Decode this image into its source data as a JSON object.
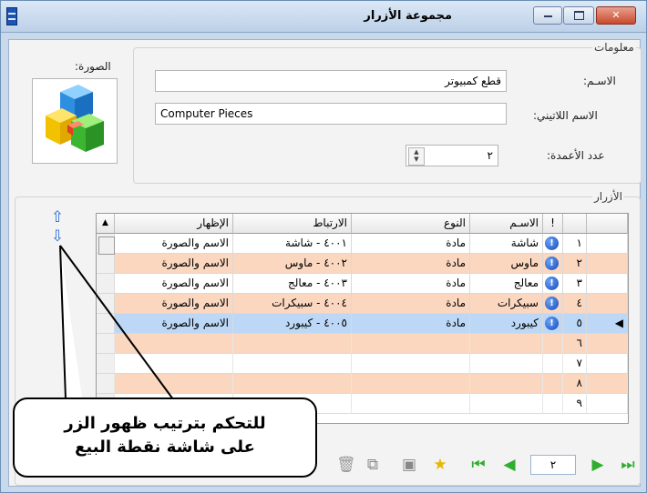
{
  "window": {
    "title": "مجموعة الأزرار"
  },
  "info_group": {
    "legend": "معلومات",
    "name_label": "الاسـم:",
    "name_value": "قطع كمبيوتر",
    "latin_label": "الاسم اللاتيني:",
    "latin_value": "Computer Pieces",
    "columns_label": "عدد الأعمدة:",
    "columns_value": "٢"
  },
  "image": {
    "label": "الصورة:",
    "icon": "colored-cubes-icon"
  },
  "buttons_group": {
    "legend": "الأزرار",
    "headers": {
      "indicator": "",
      "icon": "!",
      "name": "الاسـم",
      "type": "النوع",
      "link": "الارتباط",
      "display": "الإظهار"
    },
    "rows": [
      {
        "num": "١",
        "name": "شاشة",
        "type": "مادة",
        "link": "٤٠٠١ - شاشة",
        "display": "الاسم والصورة",
        "style": "white"
      },
      {
        "num": "٢",
        "name": "ماوس",
        "type": "مادة",
        "link": "٤٠٠٢ - ماوس",
        "display": "الاسم والصورة",
        "style": "orange"
      },
      {
        "num": "٣",
        "name": "معالج",
        "type": "مادة",
        "link": "٤٠٠٣ - معالج",
        "display": "الاسم والصورة",
        "style": "white"
      },
      {
        "num": "٤",
        "name": "سبيكرات",
        "type": "مادة",
        "link": "٤٠٠٤ - سبيكرات",
        "display": "الاسم والصورة",
        "style": "orange"
      },
      {
        "num": "٥",
        "name": "كيبورد",
        "type": "مادة",
        "link": "٤٠٠٥ - كيبورد",
        "display": "الاسم والصورة",
        "style": "selected"
      },
      {
        "num": "٦",
        "name": "",
        "type": "",
        "link": "",
        "display": "",
        "style": "orange"
      },
      {
        "num": "٧",
        "name": "",
        "type": "",
        "link": "",
        "display": "",
        "style": "white"
      },
      {
        "num": "٨",
        "name": "",
        "type": "",
        "link": "",
        "display": "",
        "style": "orange"
      },
      {
        "num": "٩",
        "name": "",
        "type": "",
        "link": "",
        "display": "",
        "style": "white"
      }
    ]
  },
  "callout": {
    "line1": "للتحكم بترتيب ظهور الزر",
    "line2": "على شاشة نقطة البيع"
  },
  "navigator": {
    "page": "٢"
  },
  "colors": {
    "accent": "#2b6fd6",
    "row_orange": "#fbd7bf",
    "row_selected": "#bcd8f6",
    "nav_green": "#2fae2f"
  }
}
